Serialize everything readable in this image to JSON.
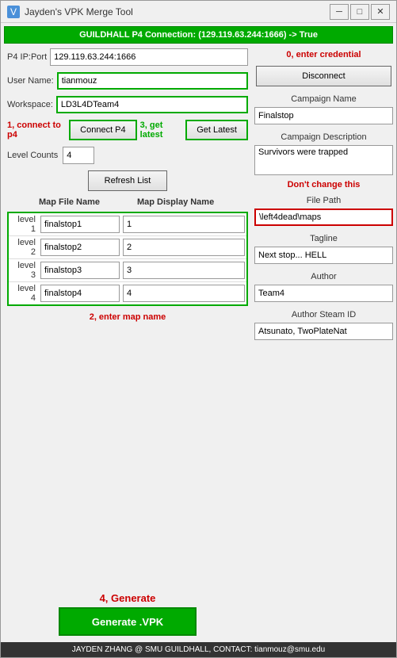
{
  "window": {
    "title": "Jayden's VPK Merge Tool",
    "icon": "V"
  },
  "titlebar": {
    "minimize": "─",
    "maximize": "□",
    "close": "✕"
  },
  "status_top": "GUILDHALL P4 Connection: (129.119.63.244:1666) -> True",
  "left_panel": {
    "p4_label": "P4 IP:Port",
    "p4_value": "129.119.63.244:1666",
    "username_label": "User Name:",
    "username_value": "tianmouz",
    "workspace_label": "Workspace:",
    "workspace_value": "LD3L4DTeam4",
    "annotation_connect": "1, connect to p4",
    "connect_btn": "Connect P4",
    "annotation_get_latest": "3, get latest",
    "get_latest_btn": "Get Latest",
    "level_counts_label": "Level Counts",
    "level_counts_value": "4",
    "refresh_btn": "Refresh List",
    "table_header_map_file": "Map File Name",
    "table_header_map_display": "Map Display Name",
    "levels": [
      {
        "label": "level 1",
        "file": "finalstop1",
        "display": "1"
      },
      {
        "label": "level 2",
        "file": "finalstop2",
        "display": "2"
      },
      {
        "label": "level 3",
        "file": "finalstop3",
        "display": "3"
      },
      {
        "label": "level 4",
        "file": "finalstop4",
        "display": "4"
      }
    ],
    "annotation_enter_map": "2, enter map name"
  },
  "right_panel": {
    "credential_annotation": "0, enter credential",
    "disconnect_btn": "Disconnect",
    "campaign_name_label": "Campaign Name",
    "campaign_name_value": "Finalstop",
    "campaign_desc_label": "Campaign Description",
    "campaign_desc_value": "Survivors were trapped",
    "dont_change_annotation": "Don't change this",
    "file_path_label": "File Path",
    "file_path_value": "\\left4dead\\maps",
    "tagline_label": "Tagline",
    "tagline_value": "Next stop... HELL",
    "author_label": "Author",
    "author_value": "Team4",
    "author_steam_id_label": "Author Steam ID",
    "author_steam_id_value": "Atsunato, TwoPlateNat"
  },
  "generate": {
    "annotation": "4, Generate",
    "btn_label": "Generate .VPK"
  },
  "status_bottom": "JAYDEN ZHANG @ SMU GUILDHALL, CONTACT: tianmouz@smu.edu"
}
